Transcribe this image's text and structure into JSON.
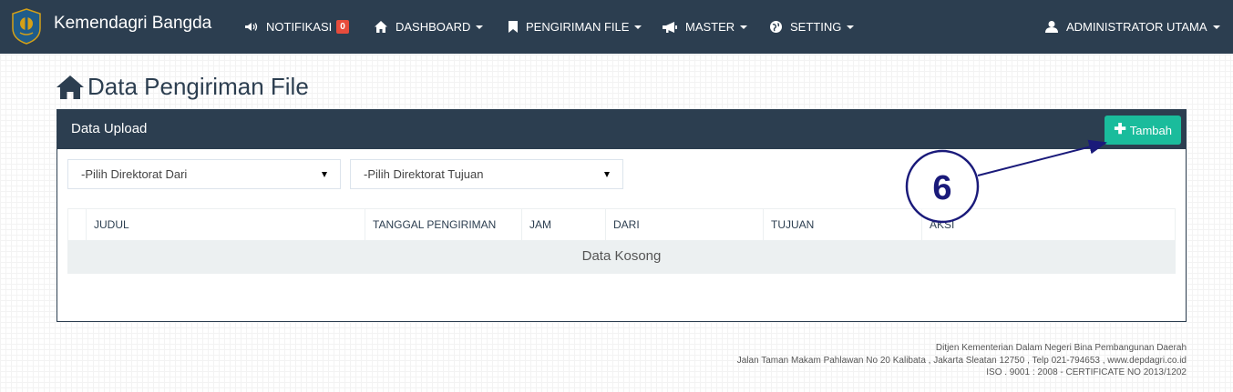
{
  "navbar": {
    "brand": "Kemendagri Bangda",
    "notifikasi_label": "NOTIFIKASI",
    "notifikasi_count": "0",
    "dashboard_label": "DASHBOARD",
    "pengiriman_label": "PENGIRIMAN FILE",
    "master_label": "MASTER",
    "setting_label": "SETTING",
    "user_label": "ADMINISTRATOR UTAMA"
  },
  "page": {
    "title": "Data Pengiriman File"
  },
  "panel": {
    "title": "Data Upload",
    "add_button_label": "Tambah",
    "filter_from_placeholder": "-Pilih Direktorat Dari",
    "filter_to_placeholder": "-Pilih Direktorat Tujuan"
  },
  "table": {
    "columns": [
      "JUDUL",
      "TANGGAL PENGIRIMAN",
      "JAM",
      "DARI",
      "TUJUAN",
      "AKSI"
    ],
    "empty_text": "Data Kosong"
  },
  "footer": {
    "line1": "Ditjen Kementerian Dalam Negeri Bina Pembangunan Daerah",
    "line2": "Jalan Taman Makam Pahlawan No 20 Kalibata , Jakarta Sleatan 12750 , Telp 021-794653 , www.depdagri.co.id",
    "line3": "ISO . 9001 : 2008 - CERTIFICATE NO 2013/1202"
  },
  "annotation": {
    "step_number": "6"
  },
  "colors": {
    "navbar": "#2c3e50",
    "accent": "#1abc9c",
    "badge": "#e74c3c",
    "annotation": "#1a1a7a"
  },
  "icons": {
    "logo": "kemendagri-logo",
    "notifikasi": "bullhorn-icon",
    "dashboard": "home-icon",
    "pengiriman": "bookmark-icon",
    "master": "megaphone-icon",
    "setting": "globe-icon",
    "user": "user-icon",
    "page_title": "home-icon",
    "tambah": "plus-icon"
  }
}
